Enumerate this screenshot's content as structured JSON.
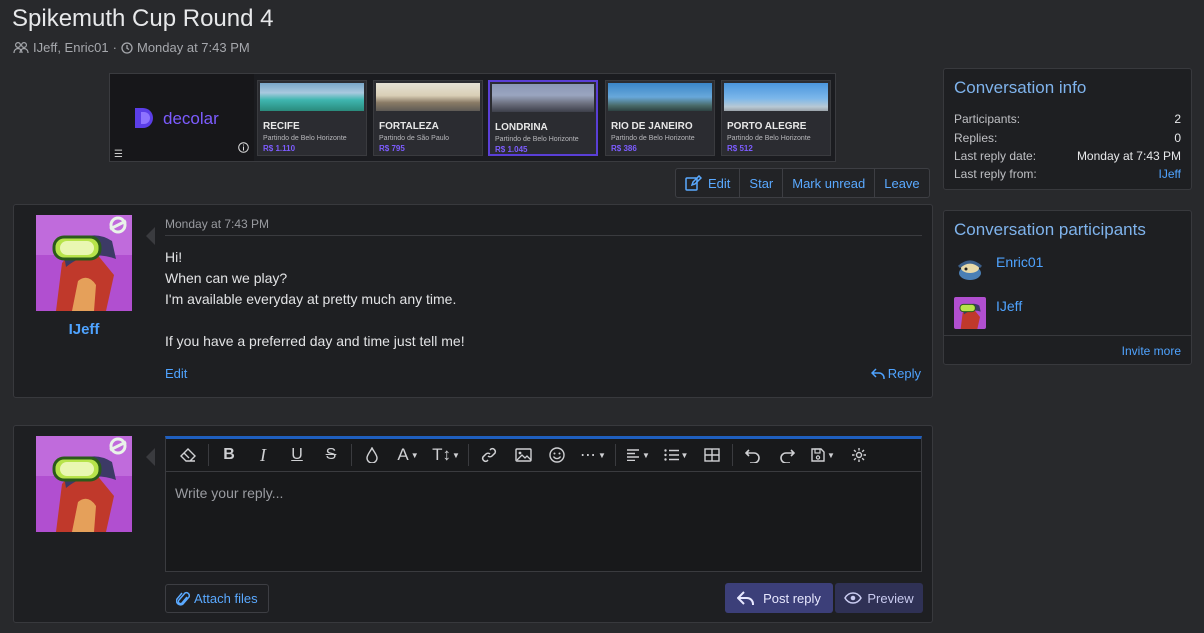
{
  "header": {
    "title": "Spikemuth Cup Round 4",
    "participants": "IJeff, Enric01",
    "separator": "·",
    "date": "Monday at 7:43 PM"
  },
  "ad": {
    "brand": "decolar",
    "cards": [
      {
        "city": "RECIFE",
        "from": "Partindo de Belo Horizonte",
        "price": "R$ 1.110",
        "selected": false
      },
      {
        "city": "FORTALEZA",
        "from": "Partindo de São Paulo",
        "price": "R$ 795",
        "selected": false
      },
      {
        "city": "LONDRINA",
        "from": "Partindo de Belo Horizonte",
        "price": "R$ 1.045",
        "selected": true
      },
      {
        "city": "RIO DE JANEIRO",
        "from": "Partindo de Belo Horizonte",
        "price": "R$ 386",
        "selected": false
      },
      {
        "city": "PORTO ALEGRE",
        "from": "Partindo de Belo Horizonte",
        "price": "R$ 512",
        "selected": false
      }
    ]
  },
  "actions": {
    "edit": "Edit",
    "star": "Star",
    "mark_unread": "Mark unread",
    "leave": "Leave"
  },
  "message": {
    "author": "IJeff",
    "date": "Monday at 7:43 PM",
    "lines": [
      "Hi!",
      "When can we play?",
      "I'm available everyday at pretty much any time.",
      "",
      "If you have a preferred day and time just tell me!"
    ],
    "edit_label": "Edit",
    "reply_label": "Reply"
  },
  "reply": {
    "placeholder": "Write your reply...",
    "attach_label": "Attach files",
    "post_label": "Post reply",
    "preview_label": "Preview"
  },
  "conversation_info": {
    "title": "Conversation info",
    "participants_label": "Participants:",
    "participants_value": "2",
    "replies_label": "Replies:",
    "replies_value": "0",
    "last_reply_date_label": "Last reply date:",
    "last_reply_date_value": "Monday at 7:43 PM",
    "last_reply_from_label": "Last reply from:",
    "last_reply_from_value": "IJeff"
  },
  "conversation_participants": {
    "title": "Conversation participants",
    "people": [
      {
        "name": "Enric01"
      },
      {
        "name": "IJeff"
      }
    ],
    "invite_label": "Invite more"
  },
  "colors": {
    "background": "#28292c",
    "panel": "#1e1f22",
    "link": "#4fa3ff",
    "accent_purple": "#7d5cff",
    "post_button": "#3c3f79"
  }
}
